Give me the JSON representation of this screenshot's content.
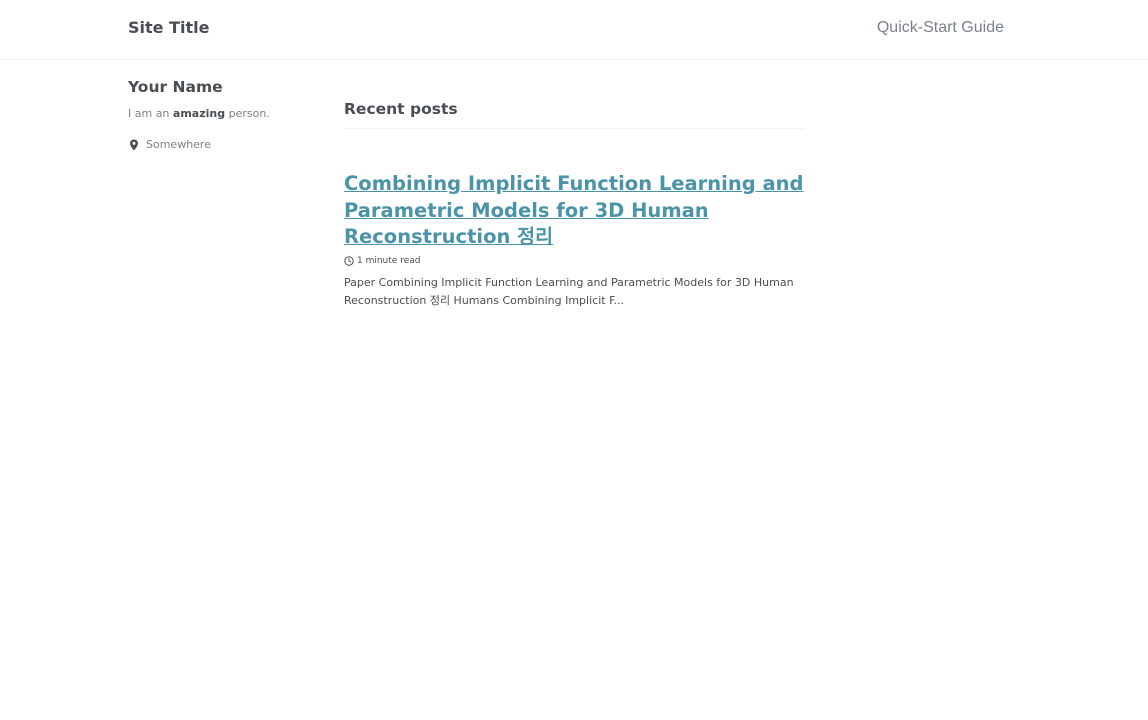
{
  "masthead": {
    "site_title": "Site Title",
    "nav": [
      {
        "label": "Quick-Start Guide"
      }
    ]
  },
  "author": {
    "name": "Your Name",
    "bio_prefix": "I am an ",
    "bio_bold": "amazing",
    "bio_suffix": " person.",
    "location": "Somewhere",
    "location_icon": "map-marker-icon"
  },
  "main": {
    "archive_title": "Recent posts",
    "posts": [
      {
        "title": "Combining Implicit Function Learning and Parametric Models for 3D Human Reconstruction 정리",
        "read_time": "1 minute read",
        "read_time_icon": "clock-icon",
        "excerpt": "Paper Combining Implicit Function Learning and Parametric Models for 3D Human Reconstruction 정리 Humans Combining Implicit F..."
      }
    ]
  },
  "colors": {
    "link": "#4b93a8",
    "text": "#494e52",
    "muted": "#7a8288",
    "border": "#f2f3f3"
  }
}
